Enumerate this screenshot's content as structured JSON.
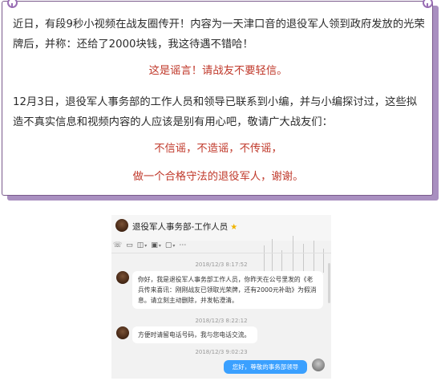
{
  "notice": {
    "para1": "近日，有段9秒小视频在战友圈传开！内容为一天津口音的退役军人领到政府发放的光荣牌后，并称：还给了2000块钱，我这待遇不错哈！",
    "warning": "这是谣言！请战友不要轻信。",
    "para2": "12月3日，退役军人事务部的工作人员和领导已联系到小编，并与小编探讨过，这些拟造不真实信息和视频内容的人应该是别有用心吧，敬请广大战友们：",
    "slogan1": "不信谣，不造谣，不传谣，",
    "slogan2": "做一个合格守法的退役军人，谢谢。"
  },
  "chat": {
    "title": "退役军人事务部-工作人员",
    "toolbar_icons": [
      "phone-icon",
      "video-icon",
      "remote-desktop-icon",
      "screen-share-icon",
      "file-icon",
      "more-icon"
    ],
    "messages": [
      {
        "timestamp": "2018/12/3 8:17:52",
        "sender": "other",
        "text": "你好，我是退役军人事务部工作人员，你昨天在公号里发的《老兵传来喜讯：刚刚战友已领取光荣牌，还有2000元补助》为假消息。请立刻主动删除，并发帖澄清。"
      },
      {
        "timestamp": "2018/12/3 8:22:12",
        "sender": "other",
        "text": "方便时请留电话号码，我与您电话交流。"
      },
      {
        "timestamp": "2018/12/3 9:02:23",
        "sender": "me",
        "text": "您好，尊敬的事务部领导"
      }
    ]
  },
  "colors": {
    "accent_purple": "#9a6fb5",
    "warning_red": "#c0392b",
    "bubble_blue": "#3aa0ff"
  }
}
